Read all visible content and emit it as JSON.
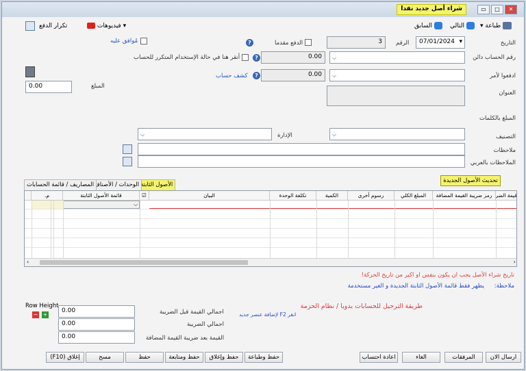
{
  "window": {
    "title": "شراء أصل جديد نقدا"
  },
  "toolbar": {
    "print": "طباعة",
    "next": "التالي",
    "prev": "السابق",
    "videos": "فيديوهات",
    "repeat_payment": "تكرار الدفع"
  },
  "form": {
    "date_label": "التاريخ",
    "date_value": "07/01/2024",
    "number_label": "الرقم",
    "number_value": "3",
    "prepaid_label": "الدفع مقدما",
    "approved_label": "مُوافق عليه",
    "account_number_label": "رقم الحساب دائن",
    "account_amount": "0.00",
    "recurring_label": "أنقر هنا في حالة الإستخدام المتكرر للحساب",
    "payto_label": "ادفعوا لأمر",
    "payto_amount": "0.00",
    "statement_link": "كشف حساب",
    "amount_label": "المبلغ",
    "amount_value": "0.00",
    "address_label": "العنوان",
    "amount_words_label": "المبلغ بالكلمات",
    "classification_label": "التصنيف",
    "department_label": "الإدارة",
    "notes_label": "ملاحظات",
    "notes_ar_label": "الملاحظات بالعربي"
  },
  "update_button": "تحديث الأصول الجديدة",
  "tabs": [
    {
      "label": "الأصول الثابتة",
      "active": true
    },
    {
      "label": "الوحدات / الأصناف",
      "active": false
    },
    {
      "label": "المصاريف / قائمة الحسابات",
      "active": false
    }
  ],
  "grid": {
    "headers": {
      "vat_amount": "قيمة الضر",
      "vat_code": "رمز ضريبة القيمة المضافة",
      "total": "المبلغ الكلي",
      "other_fees": "رسوم أخرى",
      "quantity": "الكمية",
      "unit_cost": "تكلفة الوحدة",
      "statement": "البيان",
      "asset_list": "قائمة الأصول الثابتة",
      "row_num": "م."
    }
  },
  "messages": {
    "warning": "تاريخ شراء الأصل يجب ان يكون بنفس او اكبر من تاريخ الحركة!",
    "note_label": "ملاحظة:",
    "note_text": "يظهر فقط قائمة الأصول الثابتة الجديدة و الغير مستخدمة",
    "posting_method": "طريقة الترحيل للحسابات يدويا / نظام الحزمة",
    "f2_hint": "انقر F2 لإضافة عنصر جديد"
  },
  "totals": {
    "row_height_label": "Row Height",
    "before_tax_label": "اجمالي القيمة قبل الضريبة",
    "before_tax_value": "0.00",
    "tax_label": "اجمالي الضريبة",
    "tax_value": "0.00",
    "after_vat_label": "القيمة بعد ضريبة القيمة المضافة",
    "after_vat_value": "0.00"
  },
  "footer": {
    "close": "إغلاق (F10)",
    "clear": "مسح",
    "save": "حفظ",
    "save_continue": "حفظ ومتابعة",
    "save_close": "حفظ وإغلاق",
    "save_print": "حفظ وطباعة",
    "repeat_accounting": "اعادة احتساب",
    "cancel": "الغاء",
    "attachments": "المرفقات",
    "send_now": "ارسال الان"
  },
  "colors": {
    "highlight_yellow": "#f4f36e",
    "warning_red": "#e23b3b",
    "note_blue": "#2548c4",
    "link_blue": "#2257c9"
  }
}
